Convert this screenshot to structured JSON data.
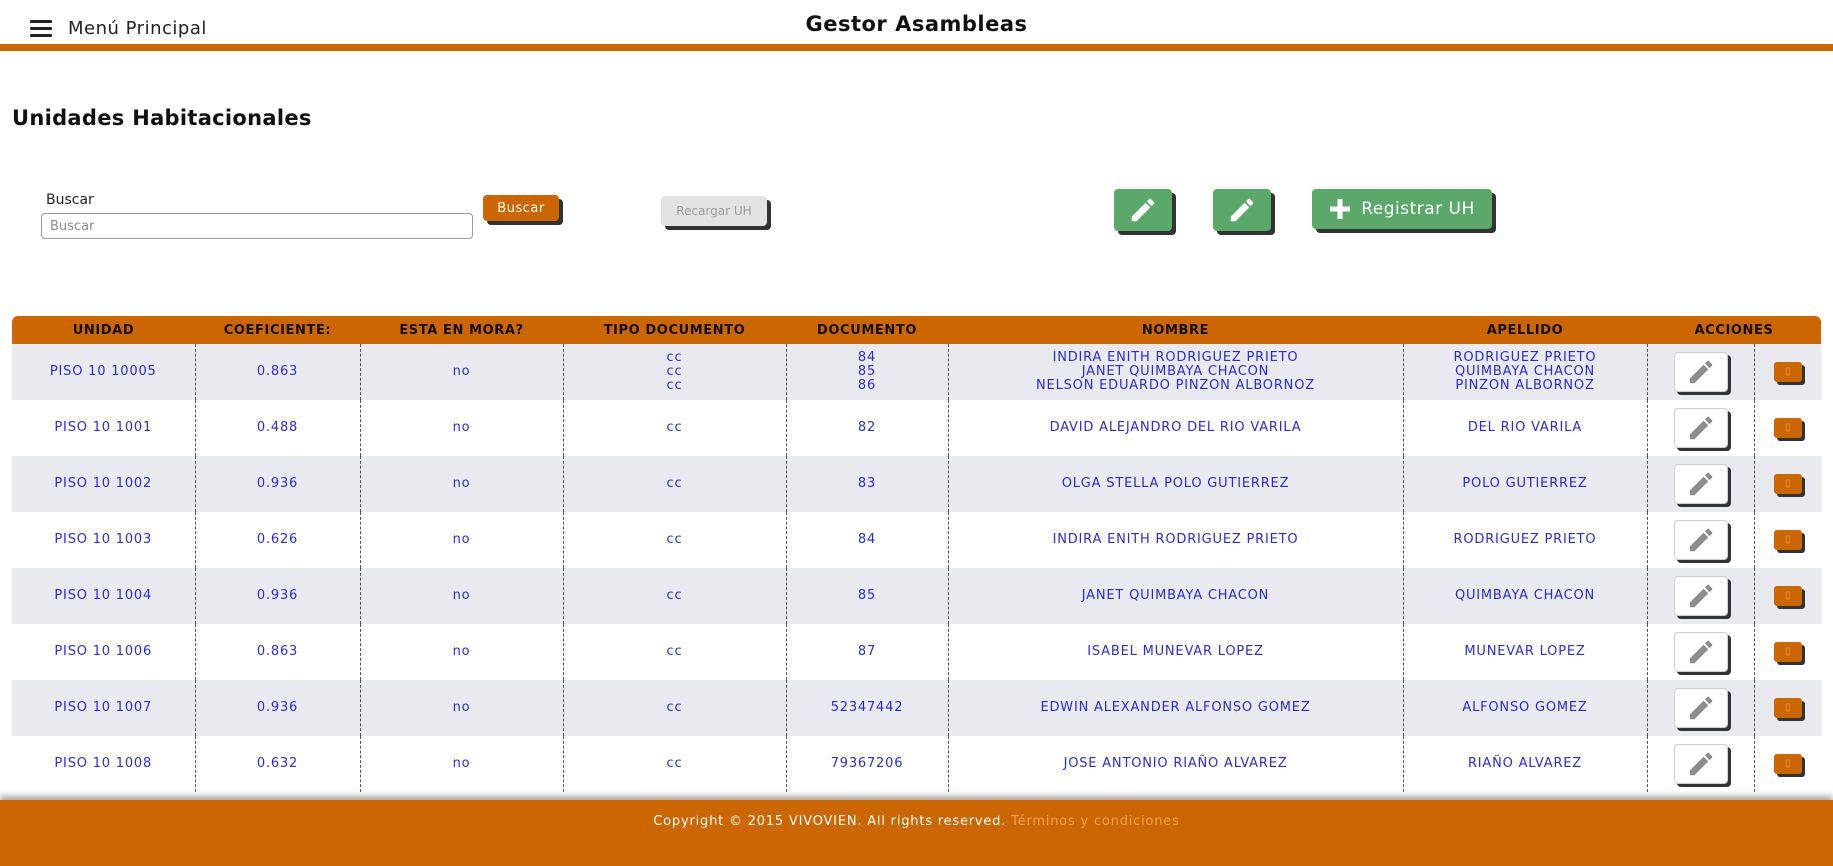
{
  "header": {
    "menu_label": "Menú Principal",
    "app_title": "Gestor Asambleas"
  },
  "page": {
    "title": "Unidades Habitacionales"
  },
  "search": {
    "label": "Buscar",
    "placeholder": "Buscar",
    "value": "",
    "button_label": "Buscar"
  },
  "toolbar": {
    "reload_label": "Recargar UH",
    "register_label": "Registrar UH"
  },
  "colors": {
    "accent": "#cc6600",
    "green": "#5aa86a",
    "row_text": "#2b2bd6"
  },
  "table": {
    "headers": [
      "UNIDAD",
      "COEFICIENTE:",
      "ESTA EN MORA?",
      "TIPO DOCUMENTO",
      "DOCUMENTO",
      "NOMBRE",
      "APELLIDO",
      "ACCIONES"
    ],
    "rows": [
      {
        "unidad": "PISO 10 10005",
        "coeficiente": "0.863",
        "mora": "no",
        "tipo": [
          "cc",
          "cc",
          "cc"
        ],
        "documento": [
          "84",
          "85",
          "86"
        ],
        "nombre": [
          "INDIRA ENITH RODRIGUEZ PRIETO",
          "JANET QUIMBAYA CHACON",
          "NELSON EDUARDO PINZON ALBORNOZ"
        ],
        "apellido": [
          "RODRIGUEZ PRIETO",
          "QUIMBAYA CHACON",
          "PINZON ALBORNOZ"
        ]
      },
      {
        "unidad": "PISO 10 1001",
        "coeficiente": "0.488",
        "mora": "no",
        "tipo": [
          "cc"
        ],
        "documento": [
          "82"
        ],
        "nombre": [
          "DAVID ALEJANDRO DEL RIO VARILA"
        ],
        "apellido": [
          "DEL RIO VARILA"
        ]
      },
      {
        "unidad": "PISO 10 1002",
        "coeficiente": "0.936",
        "mora": "no",
        "tipo": [
          "cc"
        ],
        "documento": [
          "83"
        ],
        "nombre": [
          "OLGA STELLA POLO GUTIERREZ"
        ],
        "apellido": [
          "POLO GUTIERREZ"
        ]
      },
      {
        "unidad": "PISO 10 1003",
        "coeficiente": "0.626",
        "mora": "no",
        "tipo": [
          "cc"
        ],
        "documento": [
          "84"
        ],
        "nombre": [
          "INDIRA ENITH RODRIGUEZ PRIETO"
        ],
        "apellido": [
          "RODRIGUEZ PRIETO"
        ]
      },
      {
        "unidad": "PISO 10 1004",
        "coeficiente": "0.936",
        "mora": "no",
        "tipo": [
          "cc"
        ],
        "documento": [
          "85"
        ],
        "nombre": [
          "JANET QUIMBAYA CHACON"
        ],
        "apellido": [
          "QUIMBAYA CHACON"
        ]
      },
      {
        "unidad": "PISO 10 1006",
        "coeficiente": "0.863",
        "mora": "no",
        "tipo": [
          "cc"
        ],
        "documento": [
          "87"
        ],
        "nombre": [
          "ISABEL MUNEVAR LOPEZ"
        ],
        "apellido": [
          "MUNEVAR LOPEZ"
        ]
      },
      {
        "unidad": "PISO 10 1007",
        "coeficiente": "0.936",
        "mora": "no",
        "tipo": [
          "cc"
        ],
        "documento": [
          "52347442"
        ],
        "nombre": [
          "EDWIN ALEXANDER ALFONSO GOMEZ"
        ],
        "apellido": [
          "ALFONSO GOMEZ"
        ]
      },
      {
        "unidad": "PISO 10 1008",
        "coeficiente": "0.632",
        "mora": "no",
        "tipo": [
          "cc"
        ],
        "documento": [
          "79367206"
        ],
        "nombre": [
          "JOSE ANTONIO RIAÑO ALVAREZ"
        ],
        "apellido": [
          "RIAÑO ALVAREZ"
        ]
      }
    ]
  },
  "footer": {
    "copyright": "Copyright © 2015 VIVOVIEN. All rights reserved.",
    "terms_link": "Términos y condiciones"
  }
}
